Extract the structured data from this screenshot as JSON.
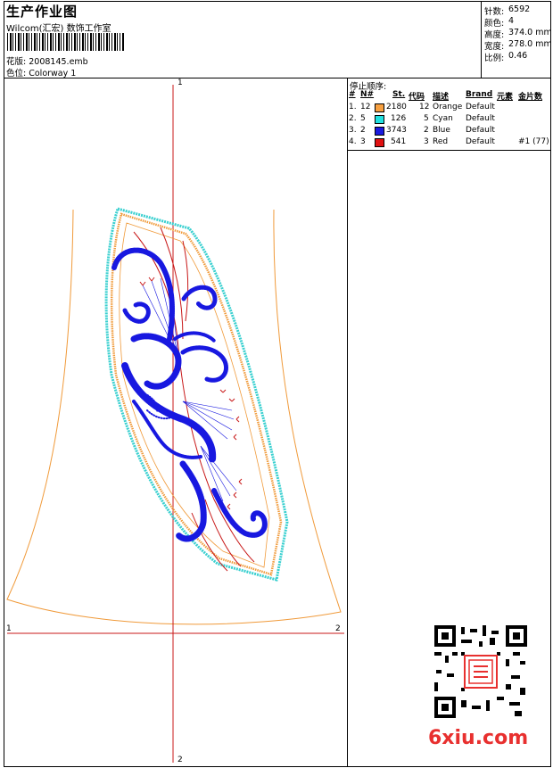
{
  "header": {
    "title": "生产作业图",
    "software": "Wilcom(汇宏) 数饰工作室",
    "design_label": "花版:",
    "design_value": "2008145.emb",
    "colorway_label": "色位:",
    "colorway_value": "Colorway 1"
  },
  "stats": [
    {
      "label": "针数:",
      "value": "6592"
    },
    {
      "label": "颜色:",
      "value": "4"
    },
    {
      "label": "高度:",
      "value": "374.0 mm"
    },
    {
      "label": "宽度:",
      "value": "278.0 mm"
    },
    {
      "label": "比例:",
      "value": "0.46"
    }
  ],
  "stop_sequence": {
    "title": "停止顺序:",
    "headers": [
      "#",
      "N#",
      "St.",
      "代码",
      "描述",
      "Brand",
      "元素",
      "金片数"
    ],
    "rows": [
      {
        "num": "1.",
        "n": "12",
        "color": "#f7a040",
        "st": "2180",
        "code": "12",
        "desc": "Orange",
        "brand": "Default",
        "elem": "",
        "seq": ""
      },
      {
        "num": "2.",
        "n": "5",
        "color": "#22e0e0",
        "st": "126",
        "code": "5",
        "desc": "Cyan",
        "brand": "Default",
        "elem": "",
        "seq": ""
      },
      {
        "num": "3.",
        "n": "2",
        "color": "#1a1adf",
        "st": "3743",
        "code": "2",
        "desc": "Blue",
        "brand": "Default",
        "elem": "",
        "seq": ""
      },
      {
        "num": "4.",
        "n": "3",
        "color": "#e01010",
        "st": "541",
        "code": "3",
        "desc": "Red",
        "brand": "Default",
        "elem": "",
        "seq": "#1 (77)"
      }
    ]
  },
  "axis_labels": {
    "top": "1",
    "left": "1",
    "right": "2",
    "bottom": "2"
  },
  "colors": {
    "orange": "#f09a3a",
    "cyan": "#3ad0d0",
    "blue": "#1818e0",
    "red": "#c81818",
    "axis": "#c81818"
  },
  "watermark": "6xiu.com"
}
